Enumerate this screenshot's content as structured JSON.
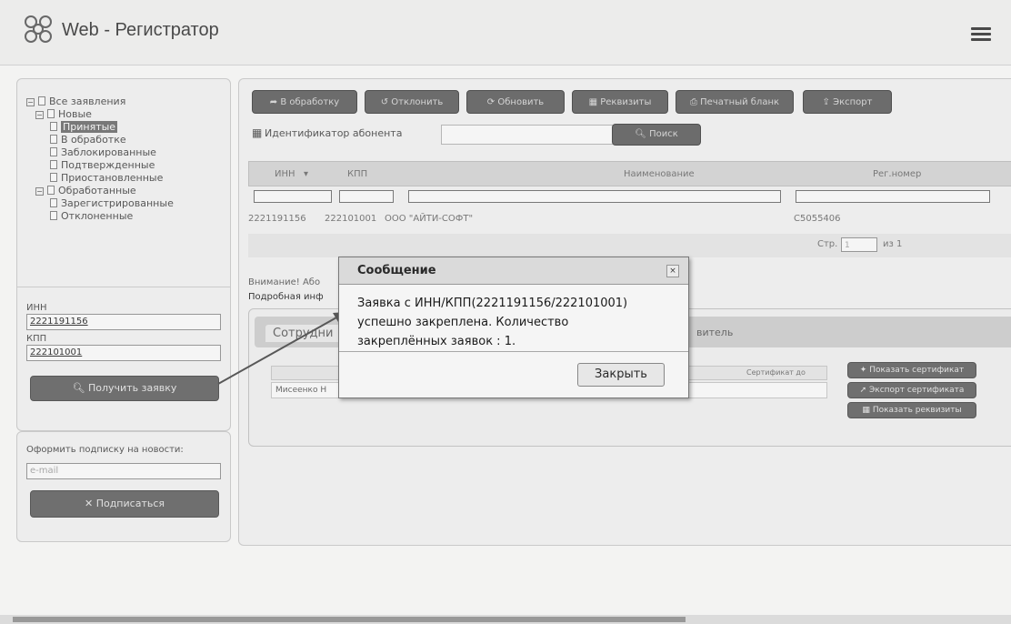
{
  "app": {
    "title": "Web - Регистратор"
  },
  "tree": {
    "root": "Все заявления",
    "new_group": "Новые",
    "items_new": [
      "Принятые",
      "В обработке",
      "Заблокированные",
      "Подтвержденные",
      "Приостановленные"
    ],
    "processed_group": "Обработанные",
    "items_processed": [
      "Зарегистрированные",
      "Отклоненные"
    ],
    "selected": "Принятые"
  },
  "request_form": {
    "inn_label": "ИНН",
    "inn_value": "2221191156",
    "kpp_label": "КПП",
    "kpp_value": "222101001",
    "get_button": "Получить заявку"
  },
  "subscribe": {
    "label": "Оформить подписку на новости:",
    "placeholder": "e-mail",
    "button": "Подписаться"
  },
  "toolbar": {
    "buttons": [
      "В обработку",
      "Отклонить",
      "Обновить",
      "Реквизиты",
      "Печатный бланк",
      "Экспорт"
    ]
  },
  "search": {
    "label": "Идентификатор абонента",
    "button": "Поиск"
  },
  "grid": {
    "columns": [
      "ИНН",
      "КПП",
      "Наименование",
      "Рег.номер"
    ],
    "rows": [
      {
        "inn": "2221191156",
        "kpp": "222101001",
        "name": "ООО \"АЙТИ-СОФТ\"",
        "reg": "С5055406"
      }
    ],
    "page_label": "Стр.",
    "page_value": "1",
    "page_of": "из 1"
  },
  "notice": {
    "line1": "Внимание! Або",
    "line2": "Подробная инф"
  },
  "details": {
    "tab_staff": "Сотрудни",
    "tab_rep": "витель",
    "cert_col": "Сертификат до",
    "row_name": "Мисеенко Н",
    "btn_show_cert": "Показать сертификат",
    "btn_export_cert": "Экспорт сертификата",
    "btn_show_req": "Показать реквизиты"
  },
  "modal": {
    "title": "Сообщение",
    "line1": "Заявка с ИНН/КПП(2221191156/222101001)",
    "line2": "успешно закреплена. Количество",
    "line3": "закреплённых заявок : 1.",
    "close_button": "Закрыть",
    "close_icon": "×"
  }
}
